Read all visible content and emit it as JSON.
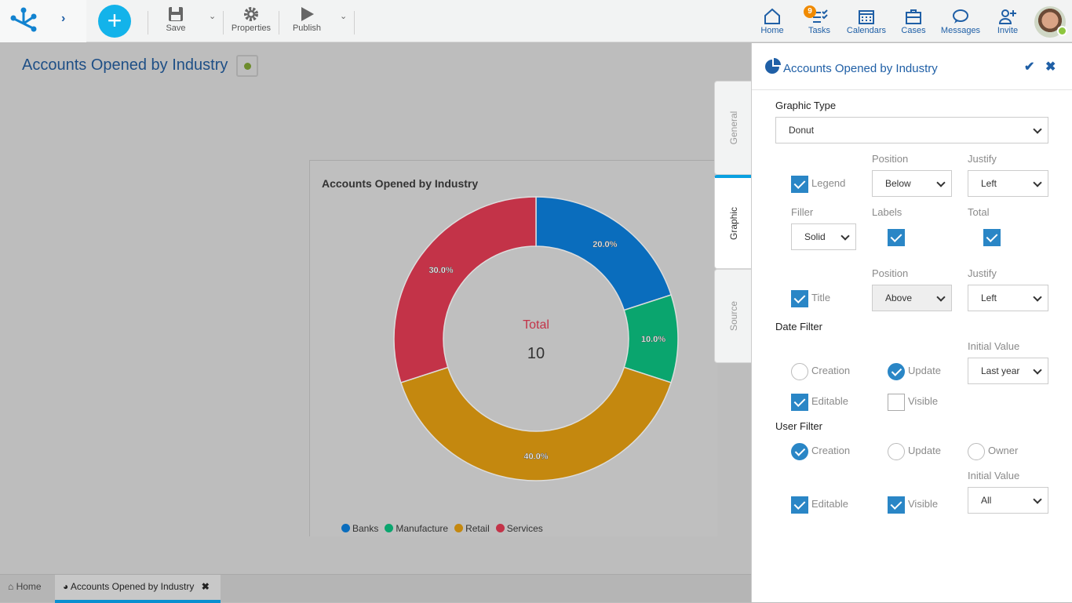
{
  "toolbar": {
    "save": "Save",
    "properties": "Properties",
    "publish": "Publish"
  },
  "nav": [
    {
      "label": "Home",
      "icon": "home-icon"
    },
    {
      "label": "Tasks",
      "icon": "tasks-icon",
      "badge": "9"
    },
    {
      "label": "Calendars",
      "icon": "calendar-icon"
    },
    {
      "label": "Cases",
      "icon": "briefcase-icon"
    },
    {
      "label": "Messages",
      "icon": "chat-icon"
    },
    {
      "label": "Invite",
      "icon": "invite-icon"
    }
  ],
  "main": {
    "title": "Accounts Opened by Industry"
  },
  "chart_data": {
    "type": "donut",
    "title": "Accounts Opened by Industry",
    "categories": [
      "Banks",
      "Manufacture",
      "Retail",
      "Services"
    ],
    "values": [
      2,
      1,
      4,
      3
    ],
    "labels": [
      "20.0%",
      "10.0%",
      "40.0%",
      "30.0%"
    ],
    "colors": [
      "#0a6dbd",
      "#0aa56e",
      "#c4880f",
      "#c33348"
    ],
    "center_label": "Total",
    "center_value": "10",
    "legend": "bottom-left"
  },
  "tabs": {
    "general": "General",
    "graphic": "Graphic",
    "source": "Source"
  },
  "panel": {
    "title": "Accounts Opened by Industry",
    "graphic_type_label": "Graphic Type",
    "graphic_type": "Donut",
    "position_label": "Position",
    "justify_label": "Justify",
    "legend_label": "Legend",
    "legend_position": "Below",
    "legend_justify": "Left",
    "filler_label": "Filler",
    "filler": "Solid",
    "labels_label": "Labels",
    "total_label": "Total",
    "title_label": "Title",
    "title_position": "Above",
    "title_justify": "Left",
    "date_filter": "Date Filter",
    "initial_value_label": "Initial Value",
    "creation": "Creation",
    "update": "Update",
    "owner": "Owner",
    "editable": "Editable",
    "visible": "Visible",
    "date_initial": "Last year",
    "user_filter": "User Filter",
    "user_initial": "All"
  },
  "bottom_tabs": {
    "home": "Home",
    "current": "Accounts Opened by Industry"
  }
}
